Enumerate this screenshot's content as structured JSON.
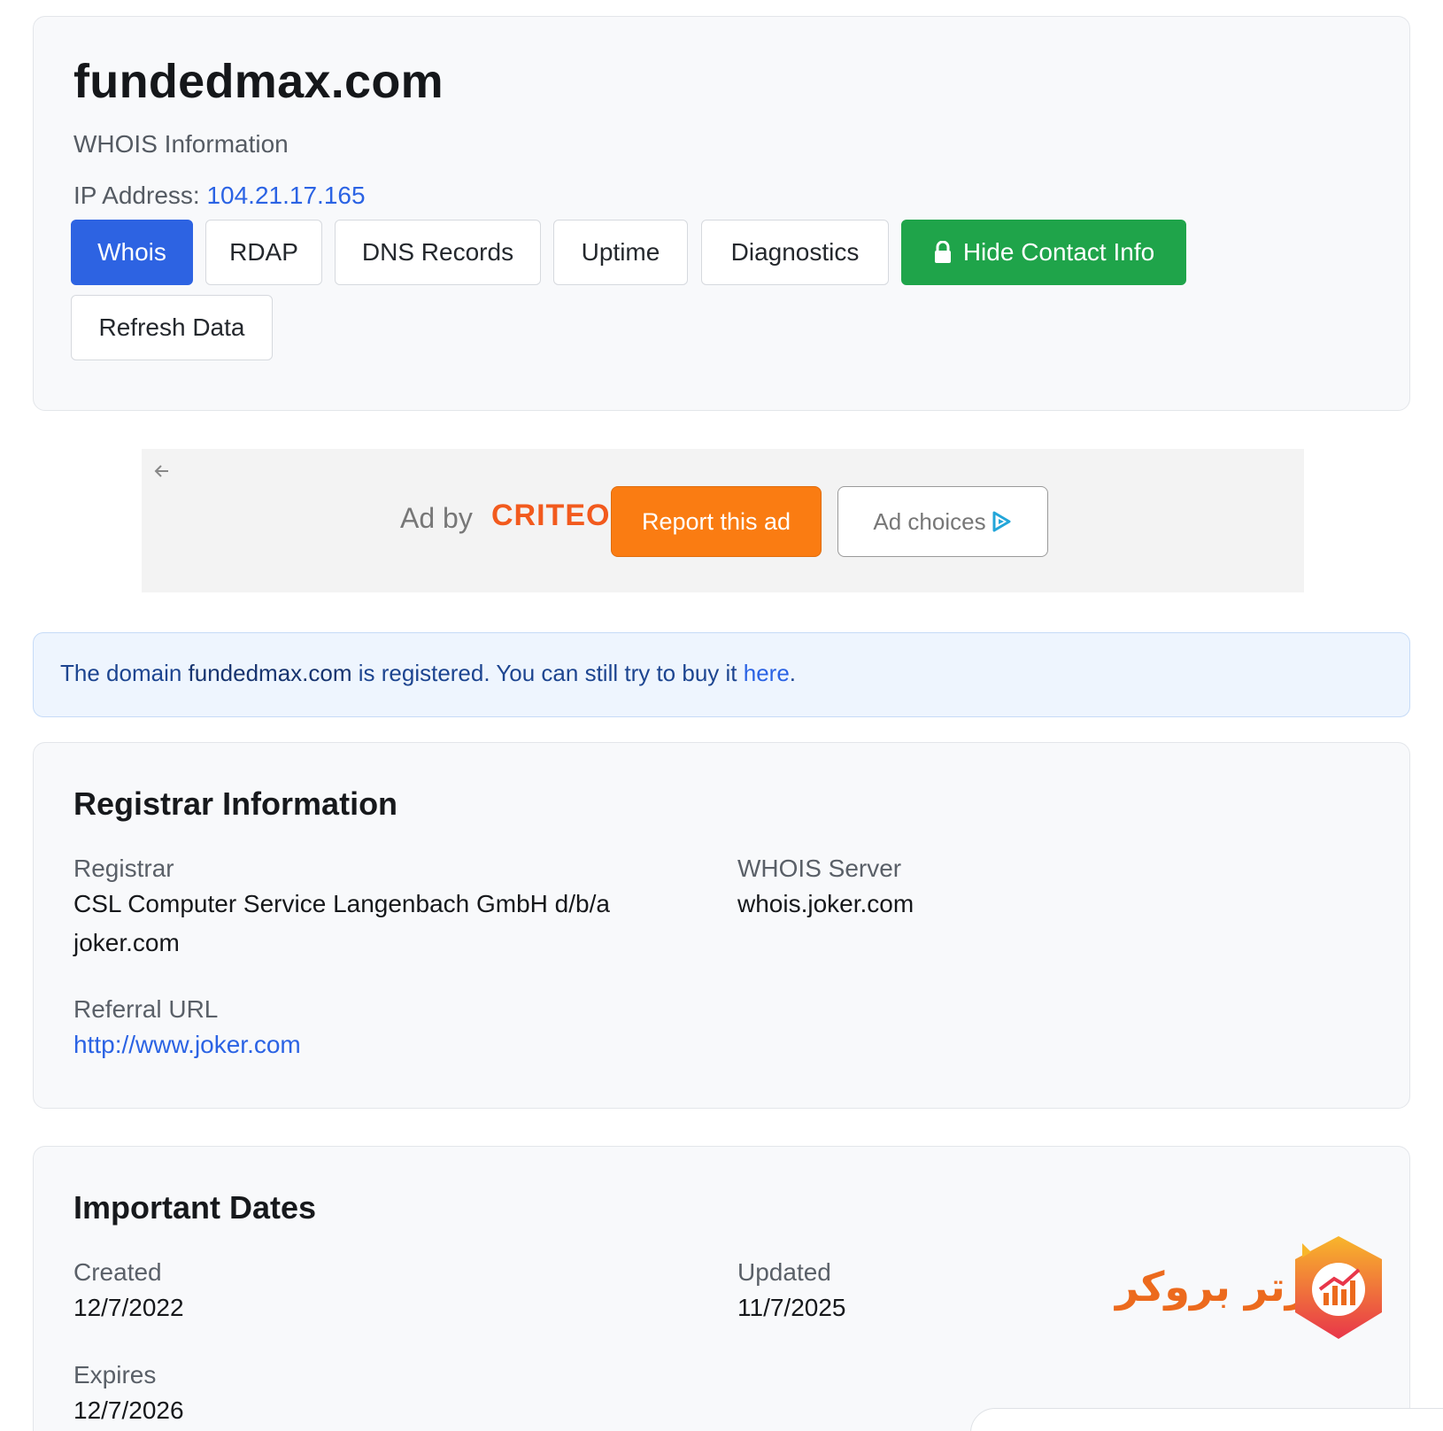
{
  "header": {
    "domain": "fundedmax.com",
    "subtitle": "WHOIS Information",
    "ip_label": "IP Address: ",
    "ip_value": "104.21.17.165"
  },
  "tabs": {
    "whois": "Whois",
    "rdap": "RDAP",
    "dns": "DNS Records",
    "uptime": "Uptime",
    "diagnostics": "Diagnostics",
    "hide_contact": "Hide Contact Info",
    "refresh": "Refresh Data"
  },
  "ad": {
    "ad_by": "Ad by",
    "brand": "CRITEO",
    "report": "Report this ad",
    "choices": "Ad choices"
  },
  "notice": {
    "prefix": "The domain ",
    "domain": "fundedmax.com",
    "middle": " is registered. You can still try to buy it ",
    "link": "here",
    "suffix": "."
  },
  "registrar": {
    "title": "Registrar Information",
    "registrar_label": "Registrar",
    "registrar_value": "CSL Computer Service Langenbach GmbH d/b/a joker.com",
    "whois_server_label": "WHOIS Server",
    "whois_server_value": "whois.joker.com",
    "referral_label": "Referral URL",
    "referral_value": "http://www.joker.com"
  },
  "dates": {
    "title": "Important Dates",
    "created_label": "Created",
    "created_value": "12/7/2022",
    "updated_label": "Updated",
    "updated_value": "11/7/2025",
    "expires_label": "Expires",
    "expires_value": "12/7/2026"
  },
  "watermark": {
    "text": "برتر بروکر"
  },
  "colors": {
    "primary": "#2d63e2",
    "success": "#1fa44a",
    "link": "#2b63e4",
    "ad_orange": "#fa7c12",
    "criteo": "#f25a1d"
  }
}
